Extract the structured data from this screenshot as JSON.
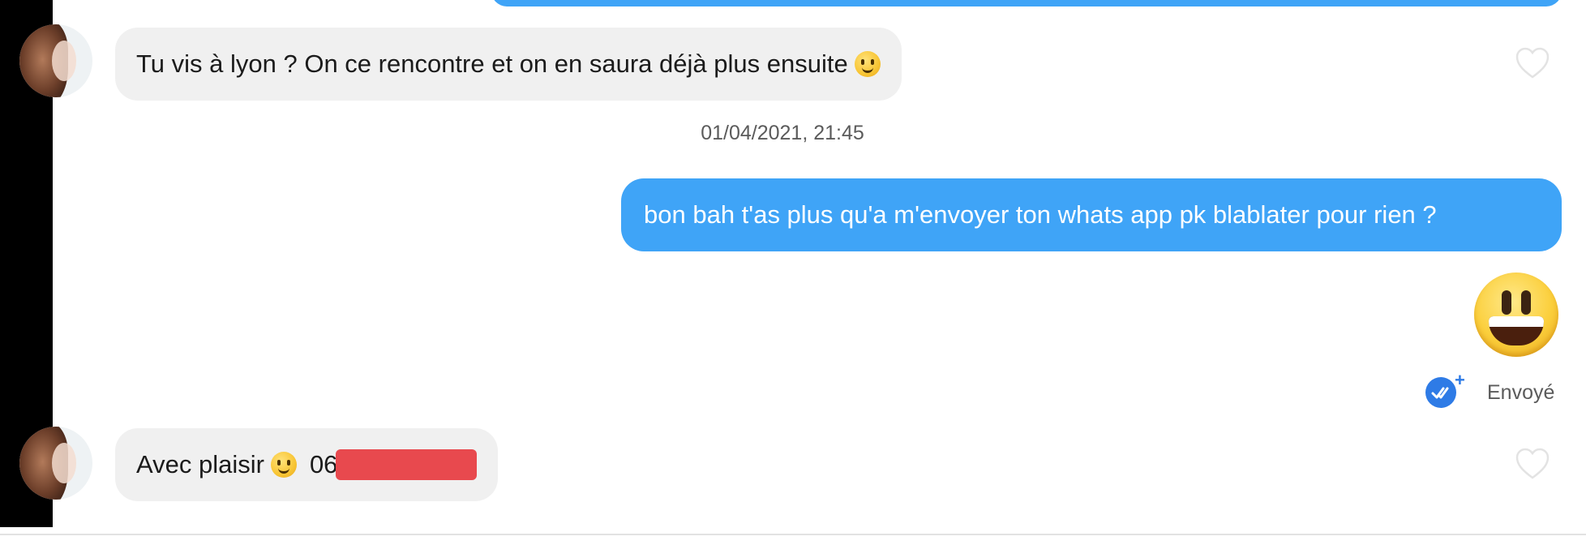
{
  "conversation": {
    "messages": [
      {
        "direction": "received",
        "text": "Tu vis à lyon ? On ce rencontre et on en saura déjà plus ensuite",
        "emoji": "slightly-smiling-face"
      },
      {
        "direction": "sent",
        "text": "bon bah t'as plus qu'a m'envoyer ton whats app pk blablater pour rien ?"
      },
      {
        "direction": "sent",
        "emoji": "grinning-face"
      },
      {
        "direction": "received",
        "text_before": "Avec plaisir",
        "emoji": "slightly-smiling-face",
        "text_after": "06",
        "redacted": true
      }
    ],
    "timestamp": "01/04/2021, 21:45",
    "status": {
      "label": "Envoyé",
      "icon": "double-check-icon",
      "extra": "+"
    }
  },
  "colors": {
    "sent_bubble": "#3fa4f7",
    "received_bubble": "#f0f0f0",
    "status_blue": "#2e7be6",
    "redaction": "#e8494e"
  }
}
